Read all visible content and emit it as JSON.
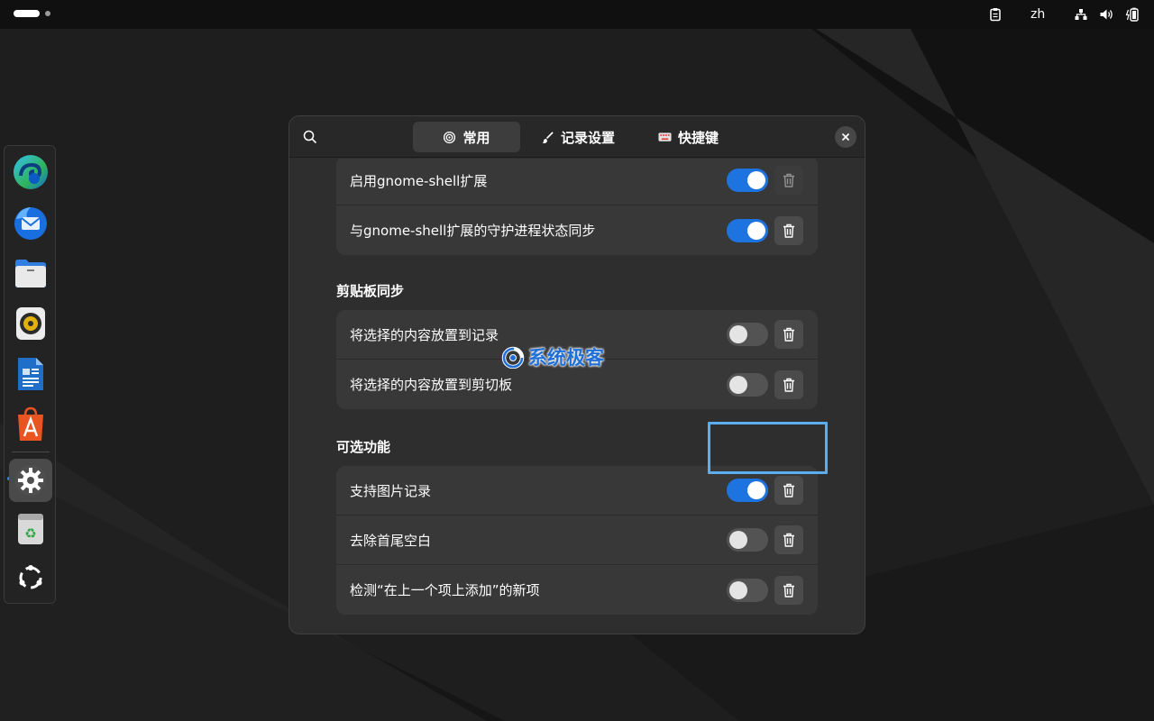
{
  "topbar": {
    "language": "zh",
    "tray_icons": [
      "clipboard-icon",
      "network-icon",
      "volume-icon",
      "battery-icon"
    ]
  },
  "dock": {
    "apps": [
      {
        "name": "edge-app-icon"
      },
      {
        "name": "thunderbird-app-icon"
      },
      {
        "name": "files-app-icon"
      },
      {
        "name": "rhythmbox-app-icon"
      },
      {
        "name": "writer-app-icon"
      },
      {
        "name": "app-center-icon"
      },
      {
        "name": "settings-app-icon"
      },
      {
        "name": "trash-app-icon"
      },
      {
        "name": "show-apps-icon"
      }
    ]
  },
  "dialog": {
    "tabs": [
      {
        "label": "常用",
        "icon": "target-icon",
        "active": true
      },
      {
        "label": "记录设置",
        "icon": "brush-icon",
        "active": false
      },
      {
        "label": "快捷键",
        "icon": "keyboard-icon",
        "active": false
      }
    ],
    "groups": [
      {
        "title": "",
        "rows": [
          {
            "label": "启用gnome-shell扩展",
            "on": true,
            "trash_disabled": true
          },
          {
            "label": "与gnome-shell扩展的守护进程状态同步",
            "on": true,
            "trash_disabled": false
          }
        ]
      },
      {
        "title": "剪贴板同步",
        "rows": [
          {
            "label": "将选择的内容放置到记录",
            "on": false,
            "trash_disabled": false
          },
          {
            "label": "将选择的内容放置到剪切板",
            "on": false,
            "trash_disabled": false
          }
        ]
      },
      {
        "title": "可选功能",
        "rows": [
          {
            "label": "支持图片记录",
            "on": true,
            "trash_disabled": false
          },
          {
            "label": "去除首尾空白",
            "on": false,
            "trash_disabled": false
          },
          {
            "label": "检测“在上一个项上添加”的新项",
            "on": false,
            "trash_disabled": false
          }
        ]
      }
    ]
  },
  "watermark": {
    "text": "系统极客"
  },
  "colors": {
    "accent": "#1d74e0",
    "highlight": "#5aaef0"
  }
}
